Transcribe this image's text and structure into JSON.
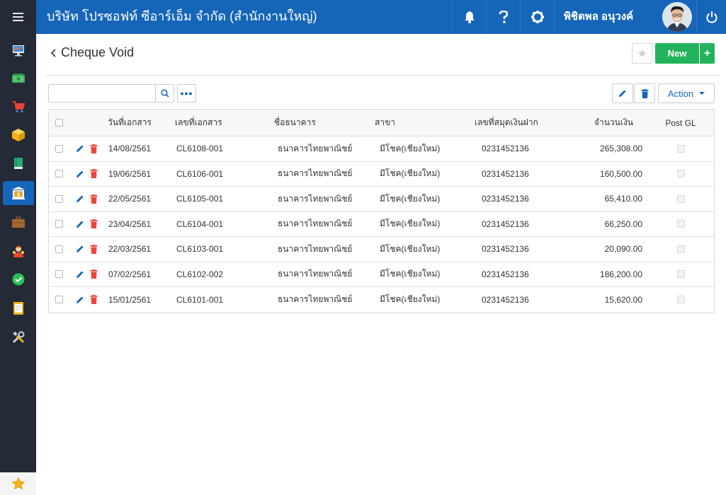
{
  "topbar": {
    "company": "บริษัท โปรซอฟท์ ซีอาร์เอ็ม จำกัด (สำนักงานใหญ่)",
    "user_name": "พิชิตพล อนุวงค์",
    "icons": [
      "bell-icon",
      "help-icon",
      "settings-icon",
      "power-icon"
    ]
  },
  "sidebar": {
    "items": [
      {
        "icon": "monitor-icon"
      },
      {
        "icon": "money-icon"
      },
      {
        "icon": "cart-icon"
      },
      {
        "icon": "box-icon"
      },
      {
        "icon": "book-icon"
      },
      {
        "icon": "bank-icon",
        "active": true
      },
      {
        "icon": "briefcase-icon"
      },
      {
        "icon": "people-icon"
      },
      {
        "icon": "check-circle-icon"
      },
      {
        "icon": "document-icon"
      },
      {
        "icon": "tools-icon"
      }
    ],
    "favorite_icon": "star-icon"
  },
  "page": {
    "title": "Cheque Void",
    "new_label": "New",
    "plus_label": "+",
    "more_label": "•••",
    "action_label": "Action",
    "search_value": ""
  },
  "table": {
    "columns": {
      "date": "วันที่เอกสาร",
      "doc_no": "เลขที่เอกสาร",
      "bank": "ชื่อธนาคาร",
      "branch": "สาขา",
      "account": "เลขที่สมุดเงินฝาก",
      "amount": "จำนวนเงิน",
      "post_gl": "Post GL"
    },
    "rows": [
      {
        "date": "14/08/2561",
        "doc_no": "CL6108-001",
        "bank": "ธนาคารไทยพาณิชย์",
        "branch": "มีโชค(เชียงใหม่)",
        "account": "0231452136",
        "amount": "265,308.00"
      },
      {
        "date": "19/06/2561",
        "doc_no": "CL6106-001",
        "bank": "ธนาคารไทยพาณิชย์",
        "branch": "มีโชค(เชียงใหม่)",
        "account": "0231452136",
        "amount": "160,500.00"
      },
      {
        "date": "22/05/2561",
        "doc_no": "CL6105-001",
        "bank": "ธนาคารไทยพาณิชย์",
        "branch": "มีโชค(เชียงใหม่)",
        "account": "0231452136",
        "amount": "65,410.00"
      },
      {
        "date": "23/04/2561",
        "doc_no": "CL6104-001",
        "bank": "ธนาคารไทยพาณิชย์",
        "branch": "มีโชค(เชียงใหม่)",
        "account": "0231452136",
        "amount": "66,250.00"
      },
      {
        "date": "22/03/2561",
        "doc_no": "CL6103-001",
        "bank": "ธนาคารไทยพาณิชย์",
        "branch": "มีโชค(เชียงใหม่)",
        "account": "0231452136",
        "amount": "20,090.00"
      },
      {
        "date": "07/02/2561",
        "doc_no": "CL6102-002",
        "bank": "ธนาคารไทยพาณิชย์",
        "branch": "มีโชค(เชียงใหม่)",
        "account": "0231452136",
        "amount": "186,200.00"
      },
      {
        "date": "15/01/2561",
        "doc_no": "CL6101-001",
        "bank": "ธนาคารไทยพาณิชย์",
        "branch": "มีโชค(เชียงใหม่)",
        "account": "0231452136",
        "amount": "15,620.00"
      }
    ]
  },
  "colors": {
    "primary": "#1565b8",
    "sidebar": "#252a37",
    "success": "#22b35c",
    "danger": "#f0453a"
  }
}
